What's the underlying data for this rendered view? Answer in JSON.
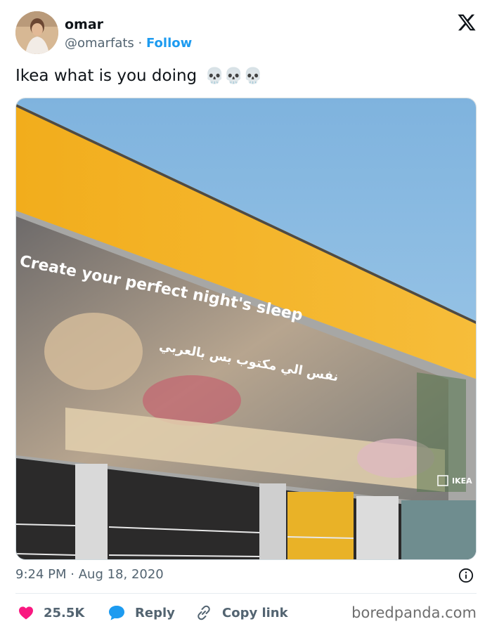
{
  "author": {
    "display_name": "omar",
    "handle": "@omarfats",
    "separator": "·",
    "follow_label": "Follow"
  },
  "tweet": {
    "text": "Ikea what is you doing",
    "emoji": "💀💀💀"
  },
  "media": {
    "banner_line1": "Create your perfect night's sleep",
    "banner_line2": "نفس الي مكتوب بس بالعربي",
    "brand_mark": "IKEA"
  },
  "meta": {
    "time": "9:24 PM",
    "separator": "·",
    "date": "Aug 18, 2020"
  },
  "actions": {
    "likes": "25.5K",
    "reply_label": "Reply",
    "copy_link_label": "Copy link"
  },
  "watermark": "boredpanda.com",
  "colors": {
    "accent": "#1d9bf0",
    "like": "#f91880",
    "sky": "#8cbbe0",
    "facade_yellow": "#f4b01f"
  },
  "icons": {
    "logo": "x-logo-icon",
    "like": "heart-icon",
    "reply": "speech-bubble-icon",
    "copy": "link-icon",
    "info": "info-icon"
  }
}
